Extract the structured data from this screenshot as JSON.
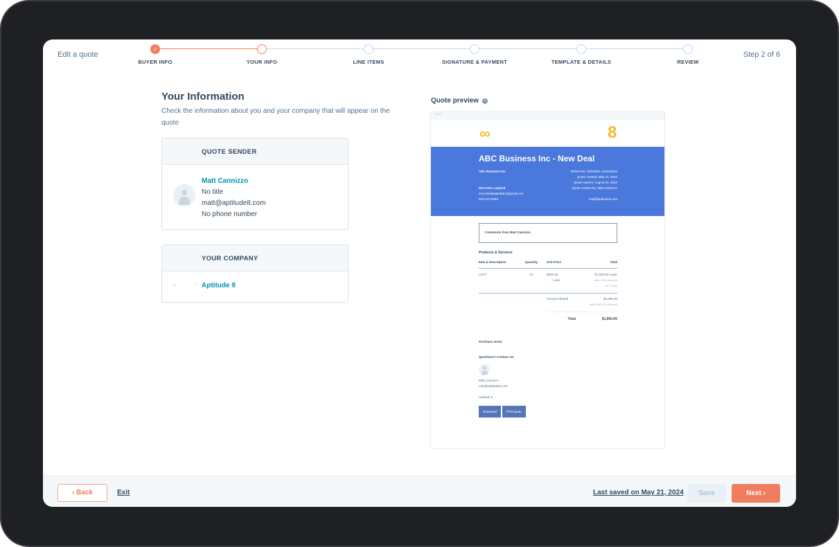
{
  "header": {
    "title": "Edit a quote",
    "step_count": "Step 2 of 6",
    "steps": [
      {
        "label": "BUYER INFO",
        "state": "complete"
      },
      {
        "label": "YOUR INFO",
        "state": "current"
      },
      {
        "label": "LINE ITEMS",
        "state": "upcoming"
      },
      {
        "label": "SIGNATURE & PAYMENT",
        "state": "upcoming"
      },
      {
        "label": "TEMPLATE & DETAILS",
        "state": "upcoming"
      },
      {
        "label": "REVIEW",
        "state": "upcoming"
      }
    ],
    "check_icon": "✓"
  },
  "main": {
    "title": "Your Information",
    "subtitle": "Check the information about you and your company that will appear on the quote",
    "sender_card": {
      "heading": "QUOTE SENDER",
      "name": "Matt Cannizzo",
      "title": "No title",
      "email": "matt@aptitude8.com",
      "phone": "No phone number"
    },
    "company_card": {
      "heading": "YOUR COMPANY",
      "logo_glyph": "∞",
      "dot_glyph": "•",
      "name": "Aptitude 8"
    }
  },
  "preview": {
    "title": "Quote preview",
    "info_icon": "i",
    "window_dots": "•••",
    "logo_left": "∞",
    "logo_right": "8",
    "banner": {
      "title": "ABC Business Inc - New Deal",
      "company": "ABC Business Inc",
      "reference": "Reference: 20240521-194426346",
      "created": "Quote created: May 21, 2024",
      "expires": "Quote expires: August 19, 2024",
      "created_by": "Quote created by: Matt Cannizzo",
      "contact_name": "McCooke Layland",
      "contact_email": "mccookelaylandabc@gmail.com",
      "contact_phone": "910-374-5053",
      "sender_email": "matt@aptitude8.com"
    },
    "comments": "Comments from Matt Cannizzo",
    "products_title": "Products & Services",
    "table": {
      "headers": [
        "Item & Description",
        "Quantity",
        "Unit Price",
        "Total"
      ],
      "rows": [
        {
          "item": "LSAT",
          "quantity": "10",
          "unit_price": "$200.00",
          "unit_period": "/ year",
          "total": "$1,800.00 / year",
          "discount": "after 10% discount",
          "term": "for 1 year"
        }
      ],
      "subtotal_label": "Annual subtotal",
      "subtotal_value": "$1,800.00",
      "subtotal_note": "after $200.00 discount",
      "total_label": "Total",
      "total_value": "$1,800.00"
    },
    "purchase_terms": "Purchase terms",
    "questions": "Questions? Contact me",
    "contact_name": "Matt Cannizzo",
    "contact_email": "matt@aptitude8.com",
    "company": "Aptitude 8",
    "download_label": "Download",
    "print_label": "Print quote"
  },
  "footer": {
    "back_label": "‹  Back",
    "exit_label": "Exit",
    "last_saved": "Last saved on May 21, 2024",
    "save_label": "Save",
    "next_label": "Next  ›"
  },
  "colors": {
    "accent": "#f07e5e",
    "link": "#0091ae",
    "banner": "#4a78dc",
    "logo": "#f5bd2e"
  }
}
